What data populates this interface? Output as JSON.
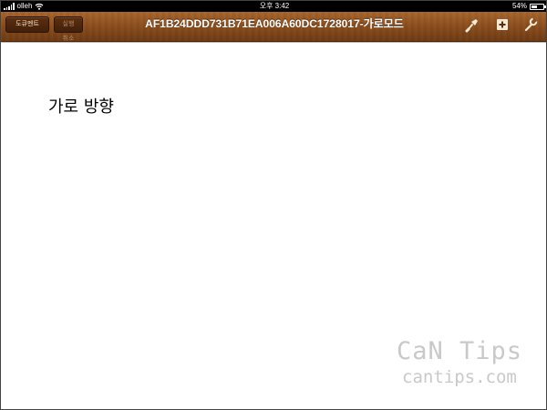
{
  "status_bar": {
    "carrier": "olleh",
    "time": "오후 3:42",
    "battery": "54%",
    "battery_level": 0.54
  },
  "toolbar": {
    "documents_label": "도큐멘트",
    "undo_label": "실행 취소",
    "title": "AF1B24DDD731B71EA006A60DC1728017-가로모드",
    "icons": [
      "brush-icon",
      "add-icon",
      "wrench-icon"
    ]
  },
  "content": {
    "text": "가로 방향"
  },
  "watermark": {
    "title": "CaN Tips",
    "subtitle": "cantips.com"
  },
  "colors": {
    "toolbar_wood": "#8e4f1d",
    "toolbar_button": "#4a250a"
  }
}
